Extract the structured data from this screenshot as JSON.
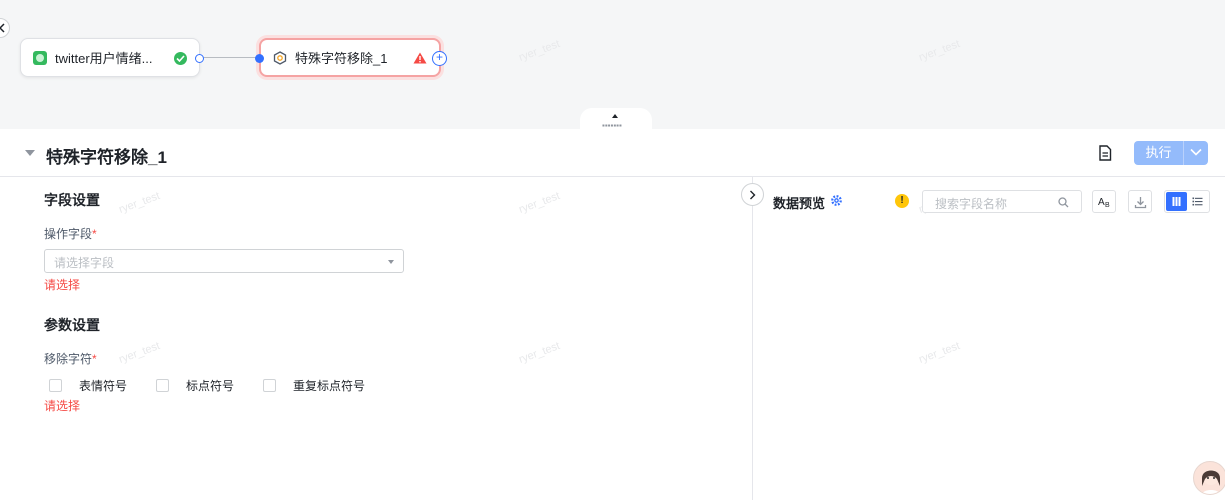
{
  "canvas": {
    "nodes": [
      {
        "label": "twitter用户情绪...",
        "icon": "dataset-icon",
        "status": "success"
      },
      {
        "label": "特殊字符移除_1",
        "icon": "operator-icon",
        "status": "warning"
      }
    ],
    "watermark": "ryer_test"
  },
  "panel": {
    "title": "特殊字符移除_1",
    "run_label": "执行"
  },
  "form": {
    "field_section_title": "字段设置",
    "operate_field_label": "操作字段",
    "operate_field_placeholder": "请选择字段",
    "operate_field_error": "请选择",
    "param_section_title": "参数设置",
    "remove_chars_label": "移除字符",
    "remove_options": [
      "表情符号",
      "标点符号",
      "重复标点符号"
    ],
    "remove_chars_error": "请选择",
    "required_mark": "*"
  },
  "preview": {
    "title": "数据预览",
    "notice_icon": "!",
    "search_placeholder": "搜索字段名称"
  },
  "colors": {
    "primary": "#3370ff",
    "error": "#f54a45",
    "success": "#34b95e",
    "warning": "#ffc60a"
  }
}
